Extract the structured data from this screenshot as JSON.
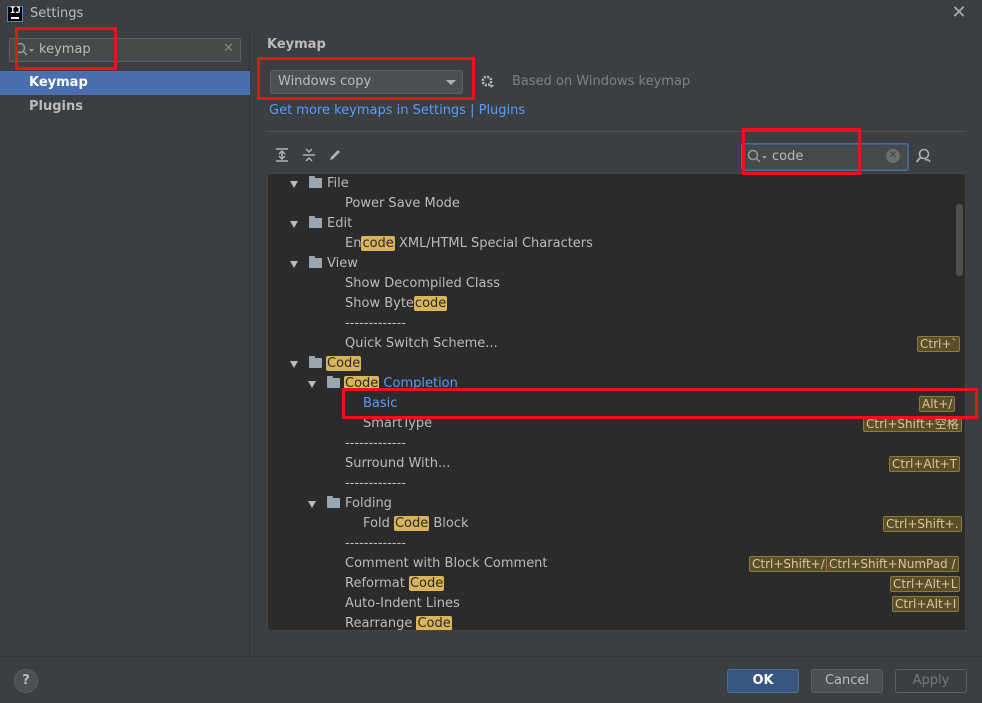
{
  "window": {
    "title": "Settings",
    "app_icon": "intellij-idea-icon",
    "close": "✕"
  },
  "sidebar": {
    "search_value": "keymap",
    "items": [
      {
        "label": "Keymap",
        "selected": true
      },
      {
        "label": "Plugins",
        "selected": false
      }
    ]
  },
  "keymap": {
    "section_title": "Keymap",
    "selected_keymap": "Windows copy",
    "based_on": "Based on Windows keymap",
    "get_more": "Get more keymaps in Settings | Plugins",
    "filter_value": "code"
  },
  "tree": {
    "file": {
      "label": "File",
      "power_save": "Power Save Mode"
    },
    "edit": {
      "label": "Edit",
      "encode_pre": "En",
      "encode_hl": "code",
      "encode_post": " XML/HTML Special Characters"
    },
    "view": {
      "label": "View",
      "decompiled": "Show Decompiled Class",
      "bytecode_pre": "Show Byte",
      "bytecode_hl": "code",
      "sep": "-------------",
      "quick_switch": "Quick Switch Scheme...",
      "quick_switch_sc": "Ctrl+`"
    },
    "code": {
      "label": "Code",
      "completion_hl": "Code",
      "completion_rest": " Completion",
      "basic": "Basic",
      "basic_sc": "Alt+/",
      "smart": "SmartType",
      "smart_sc": "Ctrl+Shift+空格",
      "sep1": "-------------",
      "surround": "Surround With...",
      "surround_sc": "Ctrl+Alt+T",
      "sep2": "-------------",
      "folding": "Folding",
      "fold_pre": "Fold ",
      "fold_hl": "Code",
      "fold_post": " Block",
      "fold_sc": "Ctrl+Shift+.",
      "sep3": "-------------",
      "comment_block": "Comment with Block Comment",
      "comment_sc1": "Ctrl+Shift+/",
      "comment_sc2": "Ctrl+Shift+NumPad /",
      "reformat_pre": "Reformat ",
      "reformat_hl": "Code",
      "reformat_sc": "Ctrl+Alt+L",
      "autoindent": "Auto-Indent Lines",
      "autoindent_sc": "Ctrl+Alt+I",
      "rearrange_pre": "Rearrange ",
      "rearrange_hl": "Code"
    }
  },
  "footer": {
    "help": "?",
    "ok": "OK",
    "cancel": "Cancel",
    "apply": "Apply"
  },
  "colors": {
    "selection": "#4b6eaf",
    "highlight": "#d8b45a",
    "link": "#589df6",
    "annotation": "#e8141c"
  }
}
